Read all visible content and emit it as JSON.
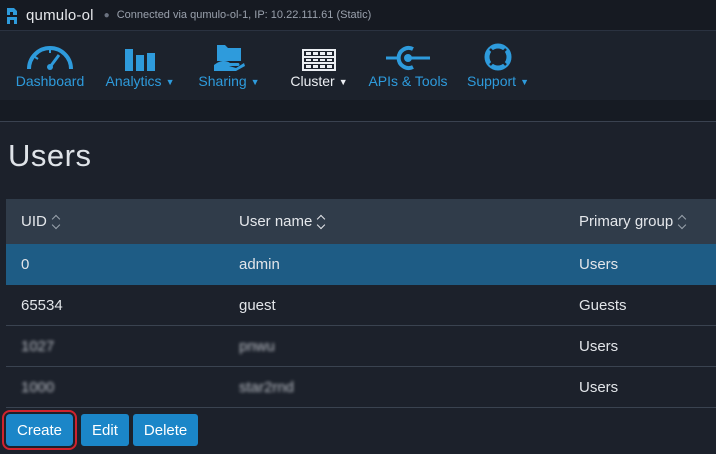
{
  "header": {
    "cluster_name": "qumulo-ol",
    "connection": "Connected via qumulo-ol-1, IP: 10.22.111.61 (Static)"
  },
  "nav": [
    {
      "label": "Dashboard",
      "icon": "dashboard-gauge-icon",
      "has_menu": false
    },
    {
      "label": "Analytics",
      "icon": "bar-chart-icon",
      "has_menu": true
    },
    {
      "label": "Sharing",
      "icon": "shared-folder-icon",
      "has_menu": true
    },
    {
      "label": "Cluster",
      "icon": "server-rack-icon",
      "has_menu": true,
      "active": true
    },
    {
      "label": "APIs & Tools",
      "icon": "api-connector-icon",
      "has_menu": false
    },
    {
      "label": "Support",
      "icon": "lifebuoy-icon",
      "has_menu": true
    }
  ],
  "page": {
    "title": "Users"
  },
  "table": {
    "columns": [
      "UID",
      "User name",
      "Primary group"
    ],
    "rows": [
      {
        "uid": "0",
        "name": "admin",
        "group": "Users",
        "selected": true,
        "obscured": false
      },
      {
        "uid": "65534",
        "name": "guest",
        "group": "Guests",
        "selected": false,
        "obscured": false
      },
      {
        "uid": "1027",
        "name": "pnwu",
        "group": "Users",
        "selected": false,
        "obscured": true
      },
      {
        "uid": "1000",
        "name": "star2rnd",
        "group": "Users",
        "selected": false,
        "obscured": true
      }
    ]
  },
  "actions": {
    "create": "Create",
    "edit": "Edit",
    "delete": "Delete"
  },
  "colors": {
    "accent": "#2e9bdc",
    "button": "#1b86c8",
    "selected_row": "#1e5c85",
    "highlight_outline": "#d0232d"
  }
}
